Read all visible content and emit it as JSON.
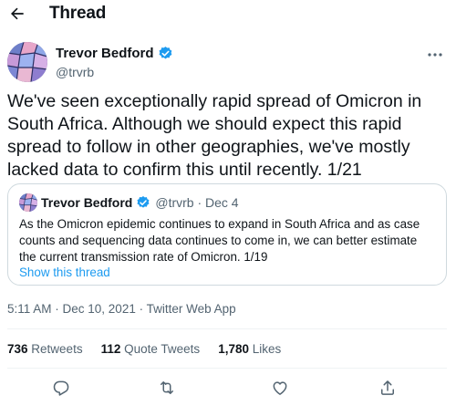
{
  "header": {
    "title": "Thread",
    "back_icon": "arrow-left-icon"
  },
  "tweet": {
    "author_name": "Trevor Bedford",
    "author_handle": "@trvrb",
    "verified_icon": "verified-badge-icon",
    "verified_color": "#1d9bf0",
    "more_icon": "more-horizontal-icon",
    "text": "We've seen exceptionally rapid spread of Omicron in South Africa. Although we should expect this rapid spread to follow in other geographies, we've mostly lacked data to confirm this until recently. 1/21",
    "timestamp": "5:11 AM · Dec 10, 2021 · Twitter Web App"
  },
  "quote": {
    "author_name": "Trevor Bedford",
    "meta": "@trvrb · Dec 4",
    "text": "As the Omicron epidemic continues to expand in South Africa and as case counts and sequencing data continues to come in, we can better estimate the current transmission rate of Omicron. 1/19",
    "show_thread": "Show this thread"
  },
  "stats": {
    "retweets_count": "736",
    "retweets_label": "Retweets",
    "quotes_count": "112",
    "quotes_label": "Quote Tweets",
    "likes_count": "1,780",
    "likes_label": "Likes"
  },
  "actions": {
    "reply_icon": "reply-icon",
    "retweet_icon": "retweet-icon",
    "like_icon": "heart-icon",
    "share_icon": "share-icon"
  },
  "colors": {
    "text_primary": "#0f1419",
    "text_secondary": "#536471",
    "link": "#1d9bf0",
    "border": "#cfd9de",
    "divider": "#eff3f4"
  }
}
